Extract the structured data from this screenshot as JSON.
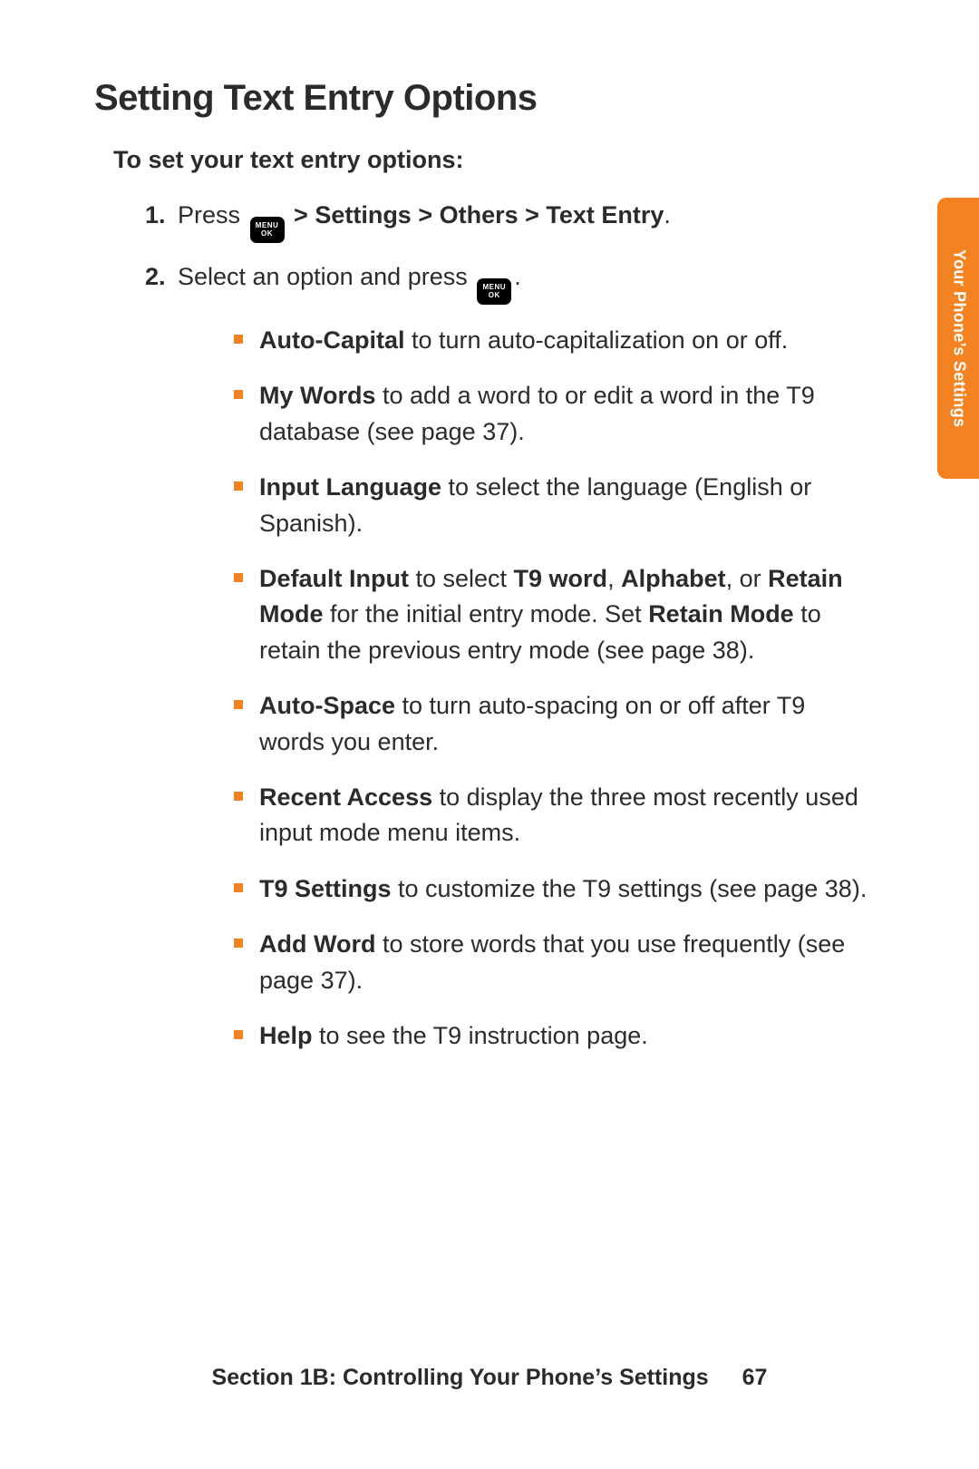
{
  "heading": "Setting Text Entry Options",
  "lead": "To set your text entry options:",
  "menuKey": {
    "top": "MENU",
    "bot": "OK"
  },
  "steps": {
    "s1": {
      "press": "Press ",
      "path": " > Settings > Others > Text Entry",
      "period": "."
    },
    "s2": {
      "text": "Select an option and press ",
      "period": "."
    }
  },
  "bullets": {
    "b0": {
      "term": "Auto-Capital",
      "rest": " to turn auto-capitalization on or off."
    },
    "b1": {
      "term": "My Words",
      "rest": " to add a word to or edit a word in the T9 database (see page 37)."
    },
    "b2": {
      "term": "Input Language",
      "rest": " to select the language (English or Spanish)."
    },
    "b3": {
      "term": "Default Input",
      "a": " to select ",
      "t9": "T9 word",
      "b": ", ",
      "alpha": "Alphabet",
      "c": ", or ",
      "retain": "Retain Mode",
      "d": " for the initial entry mode. Set ",
      "retain2": "Retain Mode",
      "e": " to retain the previous entry mode (see page 38)."
    },
    "b4": {
      "term": "Auto-Space",
      "rest": " to turn auto-spacing on or off after T9 words you enter."
    },
    "b5": {
      "term": "Recent Access",
      "rest": " to display the three most recently used input mode menu items."
    },
    "b6": {
      "term": "T9 Settings",
      "rest": " to customize the T9 settings (see page 38)."
    },
    "b7": {
      "term": "Add Word",
      "rest": " to store words that you use frequently (see page 37)."
    },
    "b8": {
      "term": "Help",
      "rest": " to see the T9 instruction page."
    }
  },
  "sideTab": "Your Phone’s Settings",
  "footer": {
    "text": "Section 1B: Controlling Your Phone’s Settings",
    "page": "67"
  }
}
